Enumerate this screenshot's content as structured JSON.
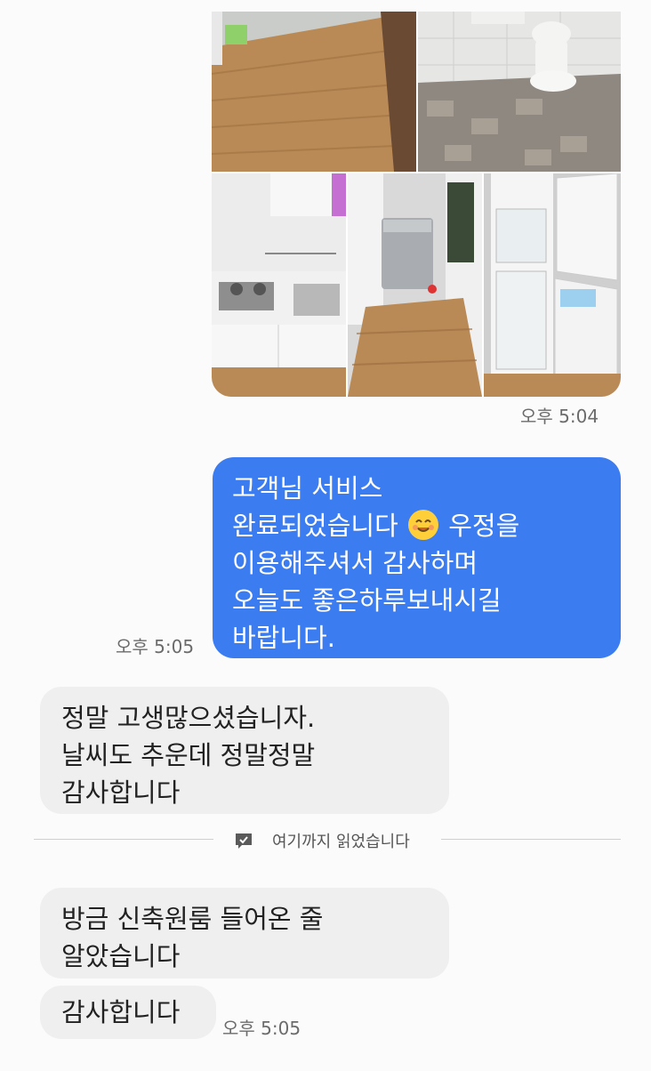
{
  "photo_time": "오후 5:04",
  "outgoing_message": {
    "lines": [
      "고객님 서비스",
      "완료되었습니다",
      "우정을",
      "이용해주셔서 감사하며",
      "오늘도 좋은하루보내시길",
      "바랍니다."
    ],
    "time": "오후 5:05"
  },
  "incoming_message_1": {
    "lines": [
      "정말 고생많으셨습니자.",
      "날씨도 추운데 정말정말",
      "감사합니다"
    ]
  },
  "read_divider": {
    "label": "여기까지 읽었습니다"
  },
  "incoming_message_2": {
    "lines": [
      "방금 신축원룸 들어온 줄",
      "알았습니다"
    ]
  },
  "incoming_message_3": {
    "text": "감사합니다",
    "time": "오후 5:05"
  },
  "colors": {
    "outgoing_bubble": "#3b7cf0",
    "incoming_bubble": "#efefef",
    "background": "#fbfbfb"
  }
}
